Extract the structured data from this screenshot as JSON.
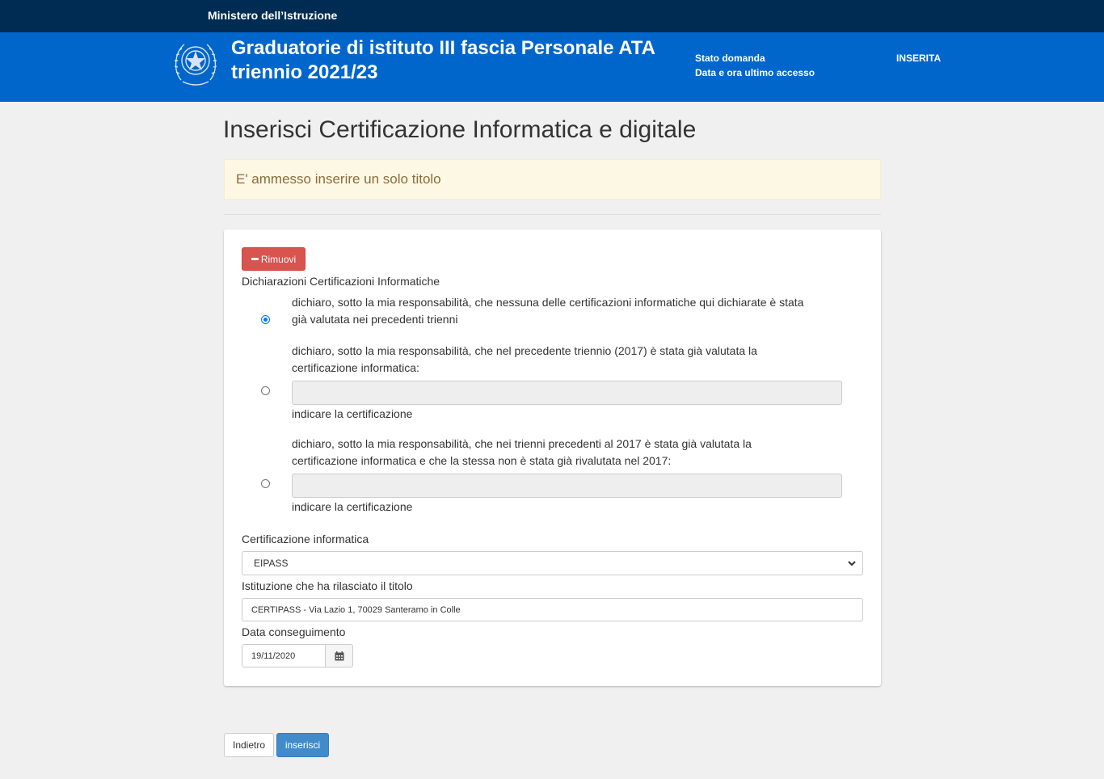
{
  "topbar": {
    "ministry": "Ministero dell’Istruzione"
  },
  "header": {
    "title_line1": "Graduatorie di istituto III fascia Personale ATA",
    "title_line2": "triennio 2021/23",
    "status_label": "Stato domanda",
    "last_access_label": "Data e ora ultimo accesso",
    "status_value": "INSERITA",
    "last_access_value": ""
  },
  "page": {
    "title": "Inserisci Certificazione Informatica e digitale",
    "alert": "E' ammesso inserire un solo titolo"
  },
  "form": {
    "remove_button": "Rimuovi",
    "declarations_label": "Dichiarazioni Certificazioni Informatiche",
    "option1_line1": "dichiaro, sotto la mia responsabilità, che nessuna delle certificazioni informatiche qui dichiarate è stata",
    "option1_line2": "già valutata nei precedenti trienni",
    "option2_line1": "dichiaro, sotto la mia responsabilità, che nel precedente triennio (2017) è stata già valutata la",
    "option2_line2": "certificazione informatica:",
    "option2_hint": "indicare la certificazione",
    "option2_value": "",
    "option3_line1": "dichiaro, sotto la mia responsabilità, che nei trienni precedenti al 2017 è stata già valutata la",
    "option3_line2": "certificazione informatica e che la stessa non è stata già rivalutata nel 2017:",
    "option3_hint": "indicare la certificazione",
    "option3_value": "",
    "selected_option": 1,
    "cert_label": "Certificazione informatica",
    "cert_value": "EIPASS",
    "institution_label": "Istituzione che ha rilasciato il titolo",
    "institution_value": "CERTIPASS - Via Lazio 1, 70029 Santeramo in Colle",
    "date_label": "Data conseguimento",
    "date_value": "19/11/2020"
  },
  "actions": {
    "back": "Indietro",
    "submit": "inserisci"
  },
  "icons": {
    "emblem": "italian-republic-emblem-icon",
    "remove": "minus-icon",
    "select": "chevron-down-icon",
    "date": "calendar-icon"
  },
  "colors": {
    "topbar": "#002b52",
    "header": "#0066cc",
    "remove_button": "#d9534f",
    "submit_button": "#428bca",
    "alert_bg": "#fcf8e3",
    "alert_text": "#8a6d3b"
  }
}
